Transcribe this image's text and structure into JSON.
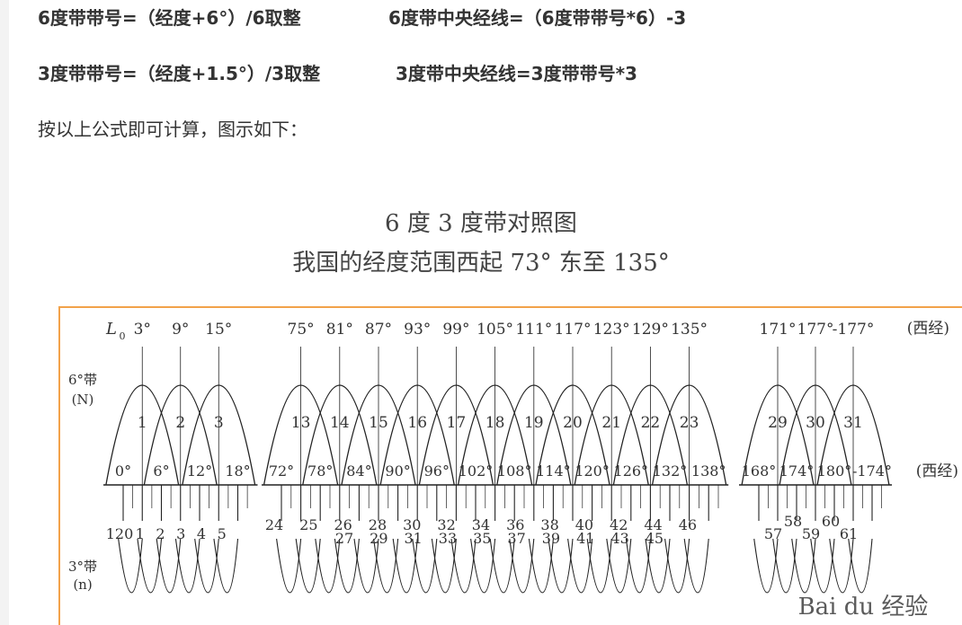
{
  "formulas": {
    "six_deg_number": "6度带带号=（经度+6°）/6取整",
    "six_deg_meridian": "6度带中央经线=（6度带带号*6）-3",
    "three_deg_number": "3度带带号=（经度+1.5°）/3取整",
    "three_deg_meridian": "3度带中央经线=3度带带号*3"
  },
  "intro_text": "按以上公式即可计算，图示如下：",
  "figure": {
    "title": "6 度 3 度带对照图",
    "subtitle": "我国的经度范围西起  73°  东至 135°",
    "frame_color": "#f2a24a",
    "row_label_6": "6°带",
    "row_label_6_sym": "(N)",
    "row_label_3": "3°带",
    "row_label_3_sym": "(n)",
    "l0_label": "L",
    "l0_sub": "0",
    "west_label": "(西经)",
    "watermark": "Bai du 经验",
    "groups": [
      {
        "central_meridians": [
          "3°",
          "9°",
          "15°"
        ],
        "zone_numbers": [
          "1",
          "2",
          "3"
        ],
        "boundaries": [
          "0°",
          "6°",
          "12°",
          "18°"
        ],
        "three_deg_upper": [
          "120",
          "1",
          "2",
          "3",
          "4",
          "5"
        ],
        "three_deg_lower": []
      },
      {
        "central_meridians": [
          "75°",
          "81°",
          "87°",
          "93°",
          "99°",
          "105°",
          "111°",
          "117°",
          "123°",
          "129°",
          "135°"
        ],
        "zone_numbers": [
          "13",
          "14",
          "15",
          "16",
          "17",
          "18",
          "19",
          "20",
          "21",
          "22",
          "23"
        ],
        "boundaries": [
          "72°",
          "78°",
          "84°",
          "90°",
          "96°",
          "102°",
          "108°",
          "114°",
          "120°",
          "126°",
          "132°",
          "138°"
        ],
        "three_deg_upper": [
          "24",
          "25",
          "26",
          "28",
          "30",
          "32",
          "34",
          "36",
          "38",
          "40",
          "42",
          "44",
          "46"
        ],
        "three_deg_lower": [
          "27",
          "29",
          "31",
          "33",
          "35",
          "37",
          "39",
          "41",
          "43",
          "45"
        ]
      },
      {
        "central_meridians": [
          "171°",
          "177°",
          "-177°"
        ],
        "zone_numbers": [
          "29",
          "30",
          "31"
        ],
        "boundaries": [
          "168°",
          "174°",
          "180°",
          "-174°"
        ],
        "three_deg_upper": [
          "58",
          "60"
        ],
        "three_deg_lower": [
          "57",
          "59",
          "61"
        ]
      }
    ]
  }
}
